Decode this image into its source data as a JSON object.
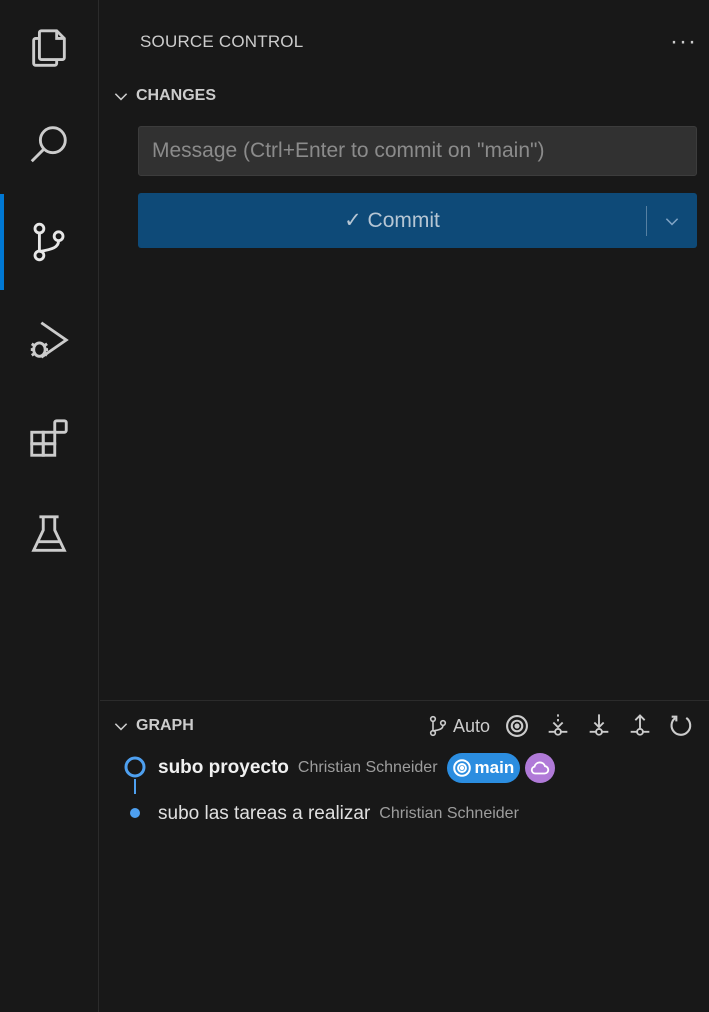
{
  "activity_bar": {
    "items": [
      {
        "name": "explorer",
        "icon": "files-icon",
        "active": false
      },
      {
        "name": "search",
        "icon": "search-icon",
        "active": false
      },
      {
        "name": "source-control",
        "icon": "source-control-icon",
        "active": true
      },
      {
        "name": "run-and-debug",
        "icon": "debug-icon",
        "active": false
      },
      {
        "name": "extensions",
        "icon": "extensions-icon",
        "active": false
      },
      {
        "name": "testing",
        "icon": "beaker-icon",
        "active": false
      }
    ],
    "accent_color": "#0078d4"
  },
  "side_bar": {
    "title": "SOURCE CONTROL",
    "more_label": "···",
    "changes": {
      "header": "CHANGES",
      "message_placeholder": "Message (Ctrl+Enter to commit on \"main\")",
      "message_value": "",
      "commit_label": "✓ Commit",
      "commit_color": "#0e4a78"
    },
    "graph": {
      "header": "GRAPH",
      "auto_label": "Auto",
      "actions": [
        "branch-icon",
        "target-icon",
        "fetch-icon",
        "pull-icon",
        "push-icon",
        "refresh-icon"
      ],
      "commits": [
        {
          "message": "subo proyecto",
          "author": "Christian Schneider",
          "branch": "main",
          "branch_color": "#2b8de0",
          "remote_icon": "cloud-icon",
          "remote_color": "#b07ad8"
        },
        {
          "message": "subo las tareas a realizar",
          "author": "Christian Schneider"
        }
      ]
    }
  }
}
